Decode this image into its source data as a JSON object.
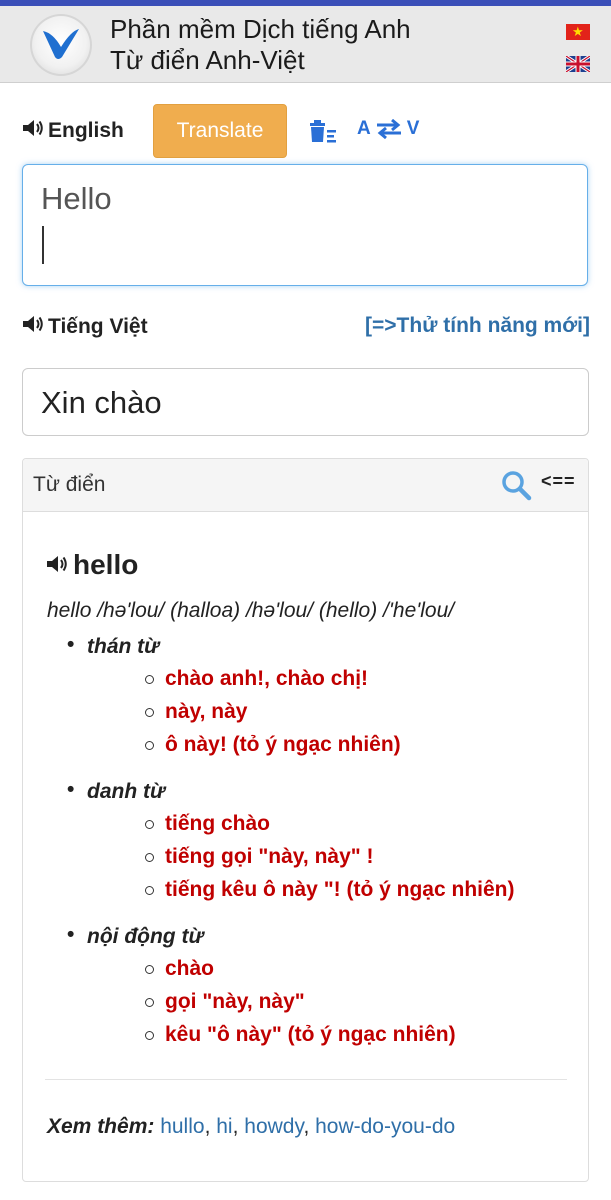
{
  "header": {
    "title_line1": "Phần mềm Dịch tiếng Anh",
    "title_line2": "Từ điển Anh-Việt"
  },
  "source": {
    "language": "English",
    "translate_button": "Translate",
    "swap_from": "A",
    "swap_to": "V",
    "input_text": "Hello"
  },
  "target": {
    "language": "Tiếng Việt",
    "try_new_link": "[=>Thử tính năng mới]",
    "output_text": "Xin chào"
  },
  "dictionary": {
    "title": "Từ điển",
    "back_label": "<==",
    "word": "hello",
    "pronunciation": "hello /hə'lou/ (halloa) /hə'lou/ (hello) /'he'lou/",
    "entries": [
      {
        "pos": "thán từ",
        "meanings": [
          "chào anh!, chào chị!",
          "này, này",
          "ô này! (tỏ ý ngạc nhiên)"
        ]
      },
      {
        "pos": "danh từ",
        "meanings": [
          "tiếng chào",
          "tiếng gọi \"này, này\" !",
          "tiếng kêu ô này \"! (tỏ ý ngạc nhiên)"
        ]
      },
      {
        "pos": "nội động từ",
        "meanings": [
          "chào",
          "gọi \"này, này\"",
          "kêu \"ô này\" (tỏ ý ngạc nhiên)"
        ]
      }
    ],
    "see_also_label": "Xem thêm:",
    "see_also": [
      "hullo",
      "hi",
      "howdy",
      "how-do-you-do"
    ]
  },
  "colors": {
    "accent_blue": "#2a6fd6",
    "link_blue": "#2f6fa8",
    "translate_orange": "#f0ad4e",
    "meaning_red": "#c00000"
  },
  "icons": [
    "app-logo-icon",
    "vietnam-flag-icon",
    "uk-flag-icon",
    "speaker-icon",
    "clear-icon",
    "swap-arrows-icon",
    "search-icon"
  ]
}
